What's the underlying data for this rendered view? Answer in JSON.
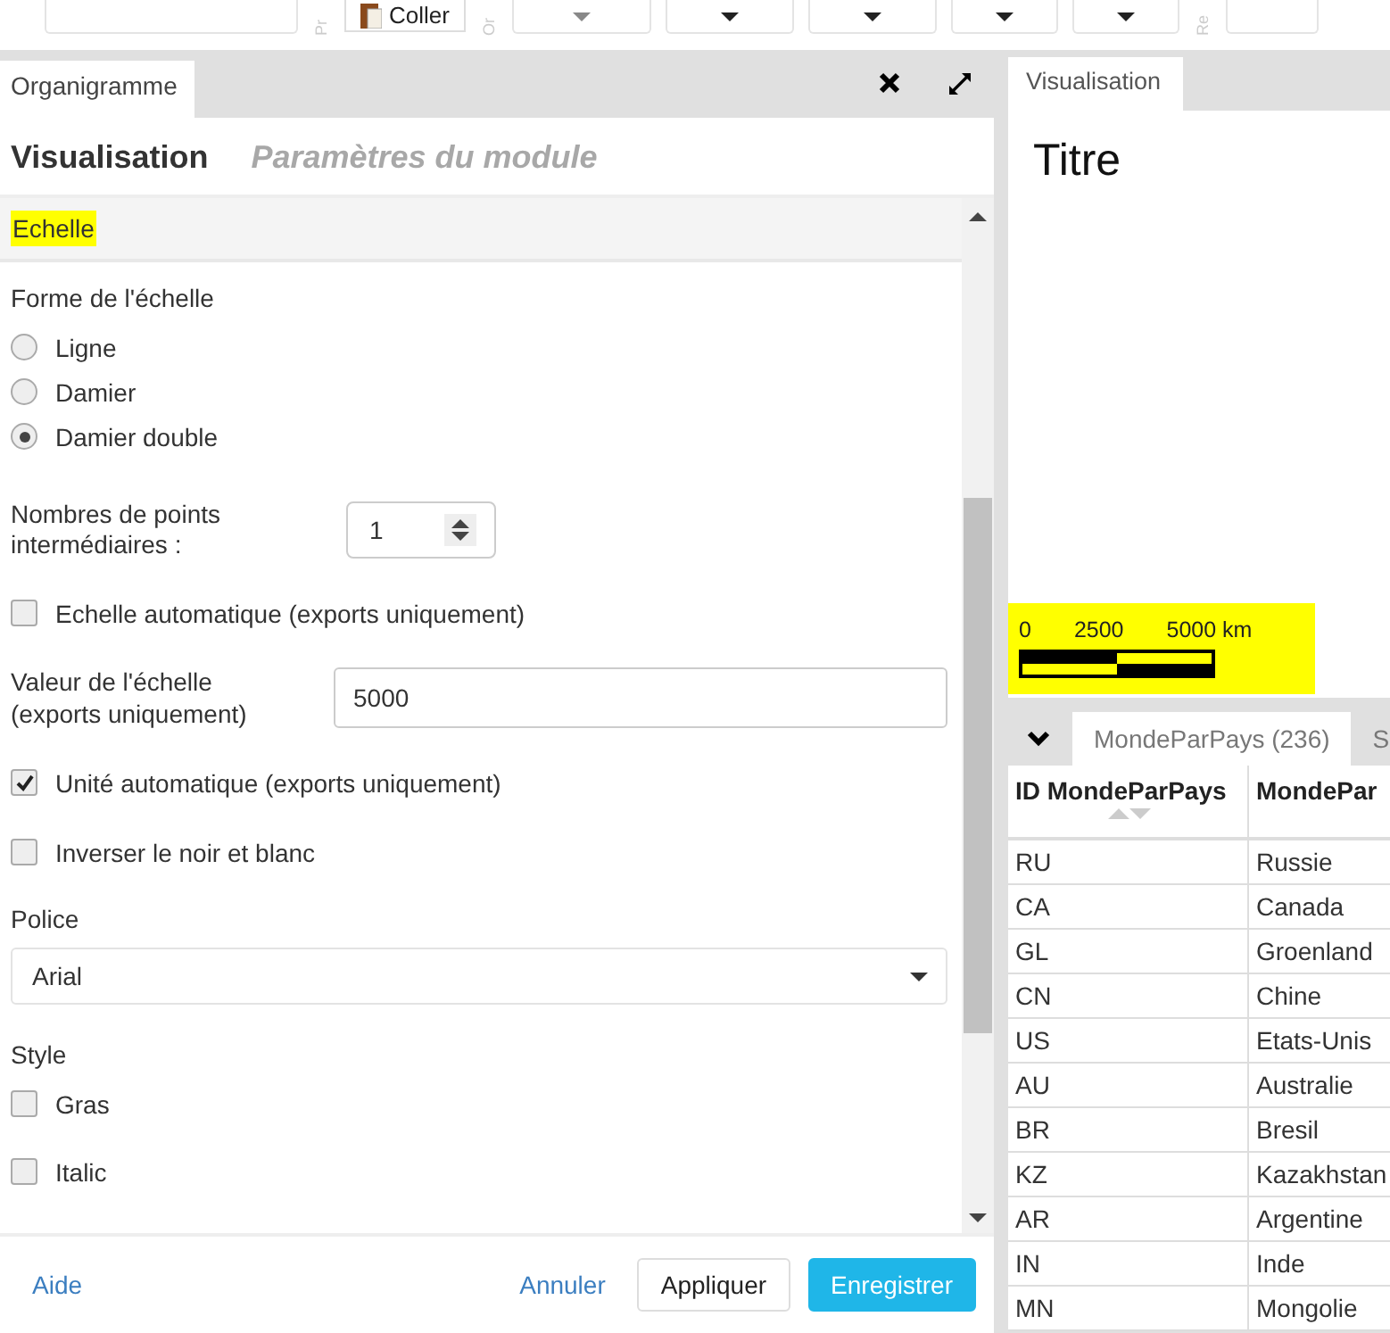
{
  "toolbar": {
    "paste_button": "Coller",
    "side_labels": [
      "Pr",
      "Or",
      "Re"
    ]
  },
  "left_panel": {
    "tab": "Organigramme",
    "header_tabs": [
      {
        "label": "Visualisation",
        "selected": true
      },
      {
        "label": "Paramètres du module",
        "selected": false
      }
    ],
    "section": {
      "title": "Echelle",
      "highlighted": true
    },
    "form": {
      "shape_label": "Forme de l'échelle",
      "shapes": [
        {
          "label": "Ligne",
          "selected": false
        },
        {
          "label": "Damier",
          "selected": false
        },
        {
          "label": "Damier double",
          "selected": true
        }
      ],
      "points_label": "Nombres de points intermédiaires :",
      "points_value": "1",
      "auto_scale": {
        "label": "Echelle automatique (exports uniquement)",
        "checked": false
      },
      "scale_value_label": "Valeur de l'échelle (exports uniquement)",
      "scale_value": "5000",
      "auto_unit": {
        "label": "Unité automatique (exports uniquement)",
        "checked": true
      },
      "invert": {
        "label": "Inverser le noir et blanc",
        "checked": false
      },
      "font_label": "Police",
      "font_value": "Arial",
      "style_label": "Style",
      "styles": [
        {
          "label": "Gras",
          "checked": false
        },
        {
          "label": "Italic",
          "checked": false
        }
      ]
    },
    "footer": {
      "help": "Aide",
      "cancel": "Annuler",
      "apply": "Appliquer",
      "save": "Enregistrer"
    }
  },
  "preview": {
    "tab": "Visualisation",
    "title": "Titre",
    "scale_labels": [
      "0",
      "2500",
      "5000 km"
    ],
    "highlighted": true
  },
  "data": {
    "tabs": [
      {
        "label": "MondeParPays (236)",
        "selected": true
      },
      {
        "label": "S",
        "selected": false
      }
    ],
    "columns": [
      "ID MondeParPays",
      "MondePar"
    ],
    "rows": [
      [
        "RU",
        "Russie"
      ],
      [
        "CA",
        "Canada"
      ],
      [
        "GL",
        "Groenland"
      ],
      [
        "CN",
        "Chine"
      ],
      [
        "US",
        "Etats-Unis"
      ],
      [
        "AU",
        "Australie"
      ],
      [
        "BR",
        "Bresil"
      ],
      [
        "KZ",
        "Kazakhstan"
      ],
      [
        "AR",
        "Argentine"
      ],
      [
        "IN",
        "Inde"
      ],
      [
        "MN",
        "Mongolie"
      ]
    ]
  }
}
